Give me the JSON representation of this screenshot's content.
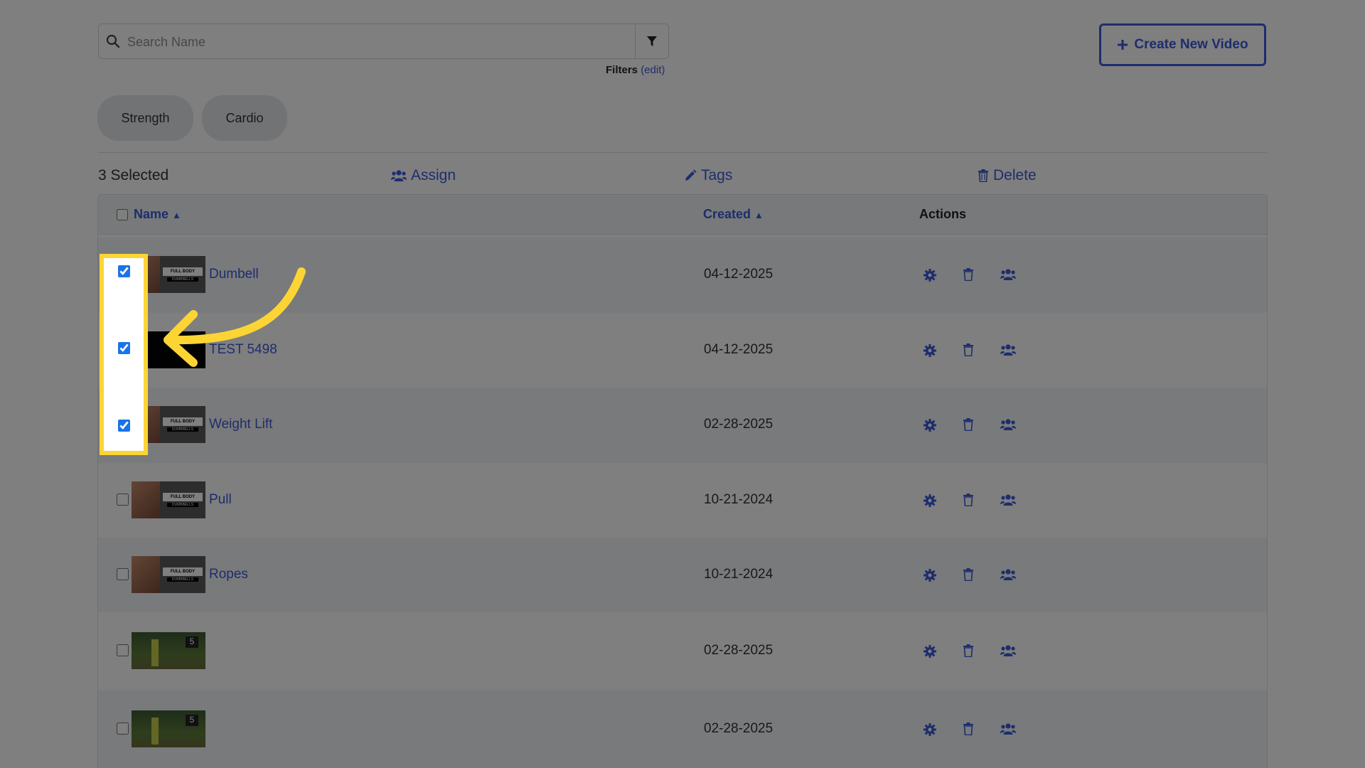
{
  "search": {
    "placeholder": "Search Name"
  },
  "filters": {
    "label": "Filters",
    "edit": "(edit)"
  },
  "create_button": "Create New Video",
  "tags": [
    "Strength",
    "Cardio"
  ],
  "bulk": {
    "selected": "3 Selected",
    "assign": "Assign",
    "tags": "Tags",
    "delete": "Delete"
  },
  "table": {
    "headers": {
      "name": "Name",
      "created": "Created",
      "actions": "Actions"
    },
    "rows": [
      {
        "name": "Dumbell",
        "date": "04-12-2025",
        "checked": true,
        "thumb": "full-body"
      },
      {
        "name": "TEST 5498",
        "date": "04-12-2025",
        "checked": true,
        "thumb": "black"
      },
      {
        "name": "Weight Lift",
        "date": "02-28-2025",
        "checked": true,
        "thumb": "full-body"
      },
      {
        "name": "Pull",
        "date": "10-21-2024",
        "checked": false,
        "thumb": "full-body"
      },
      {
        "name": "Ropes",
        "date": "10-21-2024",
        "checked": false,
        "thumb": "full-body"
      },
      {
        "name": "",
        "date": "02-28-2025",
        "checked": false,
        "thumb": "outdoor"
      },
      {
        "name": "",
        "date": "02-28-2025",
        "checked": false,
        "thumb": "outdoor"
      }
    ]
  },
  "thumb_text": {
    "line1": "FULL BODY",
    "line2": "DUMBBELLS"
  },
  "colors": {
    "accent": "#3b5bdb",
    "highlight": "#fcd535",
    "check": "#1a73e8"
  }
}
